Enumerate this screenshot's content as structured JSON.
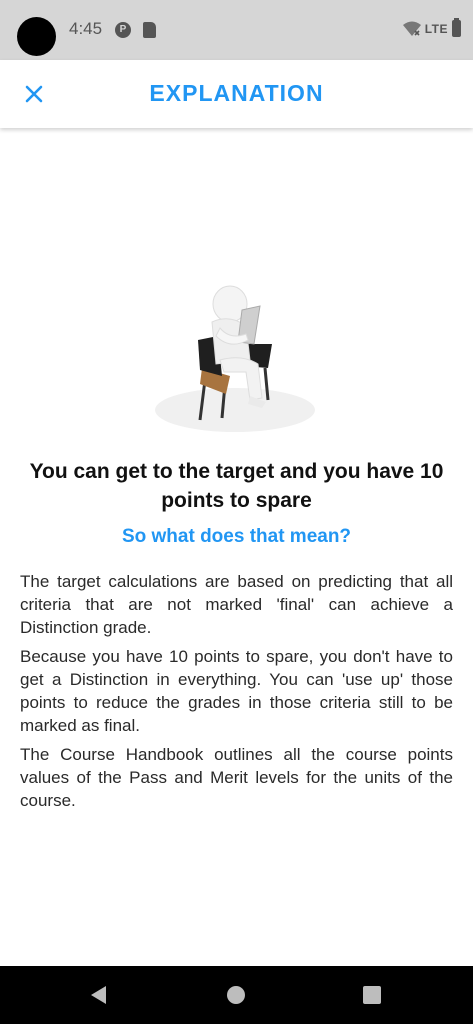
{
  "status_bar": {
    "time": "4:45",
    "network_label": "LTE"
  },
  "app_bar": {
    "title": "EXPLANATION",
    "close_icon": "close-icon",
    "accent_color": "#2196f3"
  },
  "content": {
    "illustration_icon": "reading-person-illustration",
    "headline": "You can get to the target and you have 10 points to spare",
    "subheadline": "So what does that mean?",
    "paragraphs": [
      "The target calculations are based on predicting that all criteria that are not marked 'final' can achieve a Distinction grade.",
      "Because you have 10 points to spare, you don't have to get a Distinction in everything. You can 'use up' those points to reduce the grades in those criteria still to be marked as final.",
      "The Course Handbook outlines all the course points values of the Pass and Merit levels for the units of the course."
    ]
  },
  "nav_bar": {
    "back_icon": "back-icon",
    "home_icon": "home-icon",
    "recents_icon": "recents-icon"
  }
}
